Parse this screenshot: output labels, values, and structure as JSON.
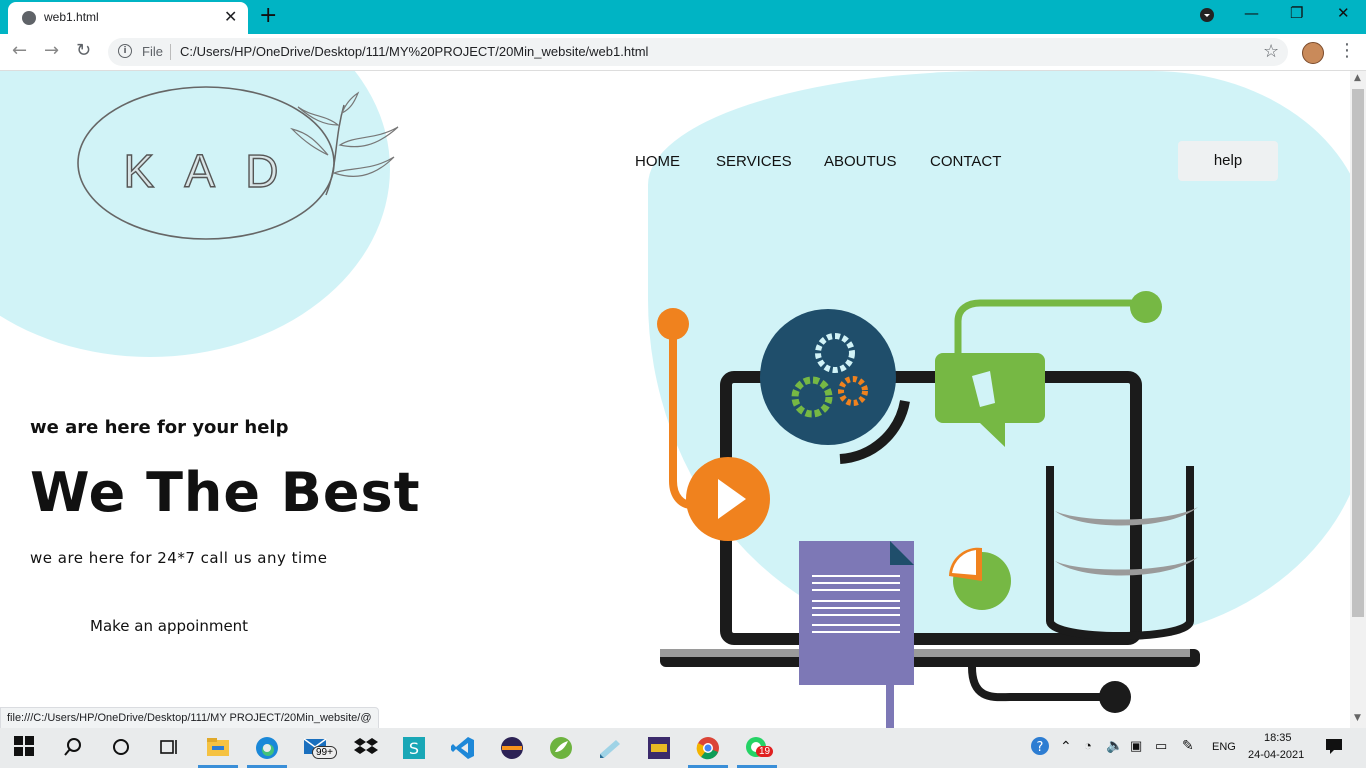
{
  "browser": {
    "tab_title": "web1.html",
    "new_tab_symbol": "+",
    "file_label": "File",
    "url": "C:/Users/HP/OneDrive/Desktop/111/MY%20PROJECT/20Min_website/web1.html",
    "status_url": "file:///C:/Users/HP/OneDrive/Desktop/111/MY PROJECT/20Min_website/@"
  },
  "site": {
    "logo_text": "K A D",
    "nav": [
      "HOME",
      "SERVICES",
      "ABOUTUS",
      "CONTACT"
    ],
    "help_label": "help",
    "tagline": "we are here for your help",
    "headline": "We The Best",
    "subline": "we are here for 24*7 call us any time",
    "cta": "Make an appoinment"
  },
  "taskbar": {
    "mail_badge": "99+",
    "whatsapp_badge": "19",
    "lang": "ENG",
    "time": "18:35",
    "date": "24-04-2021"
  },
  "colors": {
    "accent": "#00b4c4",
    "blob": "#d1f3f7",
    "orange": "#f0821e",
    "green": "#76b844",
    "navy": "#1f4e6b",
    "purple": "#7d78b6"
  }
}
